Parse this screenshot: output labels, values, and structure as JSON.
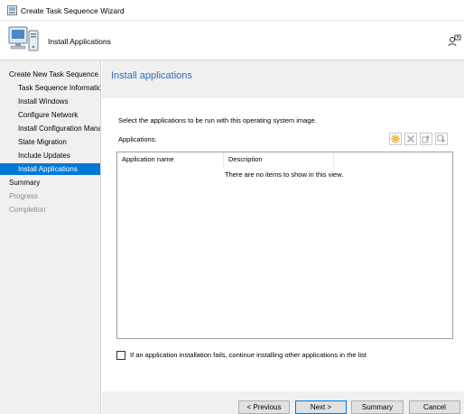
{
  "window": {
    "title": "Create Task Sequence Wizard",
    "header_title": "Install Applications"
  },
  "nav": {
    "items": [
      {
        "label": "Create New Task Sequence",
        "state": "normal"
      },
      {
        "label": "Task Sequence Information",
        "state": "normal"
      },
      {
        "label": "Install Windows",
        "state": "normal"
      },
      {
        "label": "Configure Network",
        "state": "normal"
      },
      {
        "label": "Install Configuration Manager",
        "state": "normal"
      },
      {
        "label": "State Migration",
        "state": "normal"
      },
      {
        "label": "Include Updates",
        "state": "normal"
      },
      {
        "label": "Install Applications",
        "state": "selected"
      },
      {
        "label": "Summary",
        "state": "normal"
      },
      {
        "label": "Progress",
        "state": "disabled"
      },
      {
        "label": "Completion",
        "state": "disabled"
      }
    ]
  },
  "main": {
    "page_title": "Install applications",
    "instruction": "Select the applications to be run with this operating system image.",
    "apps_label": "Applications:",
    "toolbar": {
      "icons": [
        "new-icon",
        "delete-icon",
        "move-up-icon",
        "move-down-icon"
      ]
    },
    "list": {
      "columns": [
        "Application name",
        "Description"
      ],
      "empty_message": "There are no items to show in this view."
    },
    "continue_checkbox": {
      "label": "If an application installation fails, continue installing other applications in the list",
      "checked": false
    }
  },
  "footer": {
    "previous_label": "< Previous",
    "next_label": "Next >",
    "summary_label": "Summary",
    "cancel_label": "Cancel"
  },
  "colors": {
    "accent": "#0078d7",
    "title_blue": "#2f6fb8",
    "panel_bg": "#f0f0f0"
  }
}
